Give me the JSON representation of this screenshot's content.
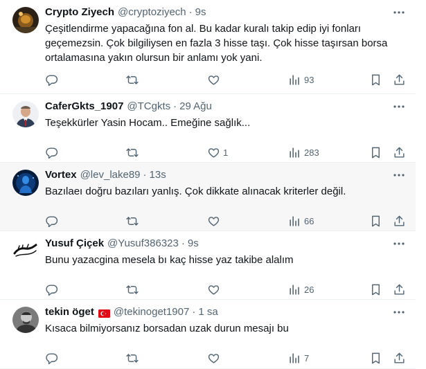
{
  "tweets": [
    {
      "name": "Crypto Ziyech",
      "handle": "@cryptoziyech",
      "time": "9s",
      "text": "Çeşitlendirme yapacağına fon al. Bu kadar kuralı takip edip iyi fonları\ngeçemezsin. Çok bilgiliysen en fazla 3 hisse taşı. Çok hisse taşırsan borsa\nortalamasına yakın olursun bir anlamı yok yani.",
      "likes": "",
      "views": "93"
    },
    {
      "name": "CaferGkts_1907",
      "handle": "@TCgkts",
      "time": "29 Ağu",
      "text": "Teşekkürler Yasin Hocam.. Emeğine sağlık...",
      "likes": "1",
      "views": "283"
    },
    {
      "name": "Vortex",
      "handle": "@lev_lake89",
      "time": "13s",
      "text": "Bazılaeı doğru bazıları yanlış. Çok dikkate alınacak kriterler değil.",
      "likes": "",
      "views": "66"
    },
    {
      "name": "Yusuf Çiçek",
      "handle": "@Yusuf386323",
      "time": "9s",
      "text": "Bunu yazacgina mesela bı kaç hisse yaz takibe alalım",
      "likes": "",
      "views": "26"
    },
    {
      "name": "tekin öget",
      "handle": "@tekinoget1907",
      "time": "1 sa",
      "text": "Kısaca bilmiyorsanız borsadan uzak durun mesajı bu",
      "likes": "",
      "views": "7"
    }
  ],
  "separator": "·",
  "icons": {
    "reply": "reply-icon",
    "retweet": "retweet-icon",
    "like": "heart-icon",
    "views": "views-icon",
    "bookmark": "bookmark-icon",
    "share": "share-icon",
    "more": "more-icon",
    "flag": "turkey-flag-icon"
  },
  "colors": {
    "text": "#0f1419",
    "secondary": "#536471",
    "border": "#eff3f4",
    "hover_bg": "#f7f7f7",
    "flag_red": "#e30a17"
  }
}
